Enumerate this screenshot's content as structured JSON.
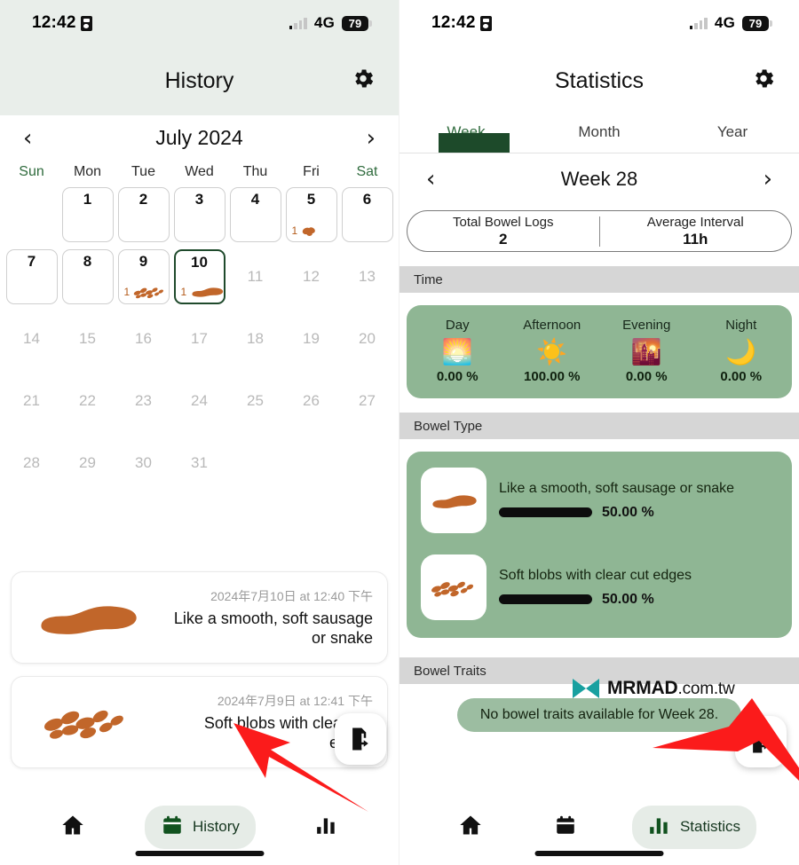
{
  "status_bar": {
    "time": "12:42",
    "network": "4G",
    "battery": "79",
    "record_icon": "record-indicator-icon"
  },
  "left": {
    "nav_title": "History",
    "settings_icon": "gear-icon",
    "calendar": {
      "prev_icon": "chevron-left-icon",
      "next_icon": "chevron-right-icon",
      "month_label": "July 2024",
      "weekdays": [
        "Sun",
        "Mon",
        "Tue",
        "Wed",
        "Thu",
        "Fri",
        "Sat"
      ],
      "lead_blanks": 1,
      "days": [
        {
          "num": "1",
          "boxed": true,
          "today": false,
          "count": null,
          "glyph": null
        },
        {
          "num": "2",
          "boxed": true,
          "today": false,
          "count": null,
          "glyph": null
        },
        {
          "num": "3",
          "boxed": true,
          "today": false,
          "count": null,
          "glyph": null
        },
        {
          "num": "4",
          "boxed": true,
          "today": false,
          "count": null,
          "glyph": null
        },
        {
          "num": "5",
          "boxed": true,
          "today": false,
          "count": "1",
          "glyph": "lumpy"
        },
        {
          "num": "6",
          "boxed": true,
          "today": false,
          "count": null,
          "glyph": null
        },
        {
          "num": "7",
          "boxed": true,
          "today": false,
          "count": null,
          "glyph": null
        },
        {
          "num": "8",
          "boxed": true,
          "today": false,
          "count": null,
          "glyph": null
        },
        {
          "num": "9",
          "boxed": true,
          "today": false,
          "count": "1",
          "glyph": "blobs"
        },
        {
          "num": "10",
          "boxed": true,
          "today": true,
          "count": "1",
          "glyph": "sausage"
        },
        {
          "num": "11",
          "boxed": false,
          "today": false,
          "count": null,
          "glyph": null
        },
        {
          "num": "12",
          "boxed": false,
          "today": false,
          "count": null,
          "glyph": null
        },
        {
          "num": "13",
          "boxed": false,
          "today": false,
          "count": null,
          "glyph": null
        },
        {
          "num": "14",
          "boxed": false,
          "today": false,
          "count": null,
          "glyph": null
        },
        {
          "num": "15",
          "boxed": false,
          "today": false,
          "count": null,
          "glyph": null
        },
        {
          "num": "16",
          "boxed": false,
          "today": false,
          "count": null,
          "glyph": null
        },
        {
          "num": "17",
          "boxed": false,
          "today": false,
          "count": null,
          "glyph": null
        },
        {
          "num": "18",
          "boxed": false,
          "today": false,
          "count": null,
          "glyph": null
        },
        {
          "num": "19",
          "boxed": false,
          "today": false,
          "count": null,
          "glyph": null
        },
        {
          "num": "20",
          "boxed": false,
          "today": false,
          "count": null,
          "glyph": null
        },
        {
          "num": "21",
          "boxed": false,
          "today": false,
          "count": null,
          "glyph": null
        },
        {
          "num": "22",
          "boxed": false,
          "today": false,
          "count": null,
          "glyph": null
        },
        {
          "num": "23",
          "boxed": false,
          "today": false,
          "count": null,
          "glyph": null
        },
        {
          "num": "24",
          "boxed": false,
          "today": false,
          "count": null,
          "glyph": null
        },
        {
          "num": "25",
          "boxed": false,
          "today": false,
          "count": null,
          "glyph": null
        },
        {
          "num": "26",
          "boxed": false,
          "today": false,
          "count": null,
          "glyph": null
        },
        {
          "num": "27",
          "boxed": false,
          "today": false,
          "count": null,
          "glyph": null
        },
        {
          "num": "28",
          "boxed": false,
          "today": false,
          "count": null,
          "glyph": null
        },
        {
          "num": "29",
          "boxed": false,
          "today": false,
          "count": null,
          "glyph": null
        },
        {
          "num": "30",
          "boxed": false,
          "today": false,
          "count": null,
          "glyph": null
        },
        {
          "num": "31",
          "boxed": false,
          "today": false,
          "count": null,
          "glyph": null
        }
      ]
    },
    "logs": [
      {
        "date": "2024年7月10日 at 12:40 下午",
        "desc": "Like a smooth, soft sausage or snake",
        "glyph": "sausage"
      },
      {
        "date": "2024年7月9日 at 12:41 下午",
        "desc": "Soft blobs with clear cut edges",
        "glyph": "blobs"
      }
    ],
    "export_icon": "export-document-icon",
    "tabs": [
      {
        "label": "",
        "icon": "home-icon",
        "active": false
      },
      {
        "label": "History",
        "icon": "calendar-icon",
        "active": true
      },
      {
        "label": "",
        "icon": "bar-chart-icon",
        "active": false
      }
    ]
  },
  "right": {
    "nav_title": "Statistics",
    "settings_icon": "gear-icon",
    "range_tabs": [
      {
        "label": "Week",
        "selected": true
      },
      {
        "label": "Month",
        "selected": false
      },
      {
        "label": "Year",
        "selected": false
      }
    ],
    "period": {
      "prev_icon": "chevron-left-icon",
      "next_icon": "chevron-right-icon",
      "label": "Week 28"
    },
    "summary": [
      {
        "key": "Total Bowel Logs",
        "value": "2"
      },
      {
        "key": "Average Interval",
        "value": "11h"
      }
    ],
    "sections": {
      "time": "Time",
      "bowel_type": "Bowel Type",
      "bowel_traits": "Bowel Traits"
    },
    "time_buckets": [
      {
        "label": "Day",
        "emoji": "🌅",
        "icon": "sunrise-icon",
        "pct": "0.00 %",
        "value": 0
      },
      {
        "label": "Afternoon",
        "emoji": "☀️",
        "icon": "sun-icon",
        "pct": "100.00 %",
        "value": 100
      },
      {
        "label": "Evening",
        "emoji": "🌇",
        "icon": "sunset-icon",
        "pct": "0.00 %",
        "value": 0
      },
      {
        "label": "Night",
        "emoji": "🌙",
        "icon": "moon-icon",
        "pct": "0.00 %",
        "value": 0
      }
    ],
    "bowel_types": [
      {
        "label": "Like a smooth, soft sausage or snake",
        "pct": "50.00 %",
        "value": 50,
        "glyph": "sausage"
      },
      {
        "label": "Soft blobs with clear cut edges",
        "pct": "50.00 %",
        "value": 50,
        "glyph": "blobs"
      }
    ],
    "traits_empty": "No bowel traits available for Week 28.",
    "export_icon": "export-document-icon",
    "tabs": [
      {
        "label": "",
        "icon": "home-icon",
        "active": false
      },
      {
        "label": "",
        "icon": "calendar-icon",
        "active": false
      },
      {
        "label": "Statistics",
        "icon": "bar-chart-icon",
        "active": true
      }
    ]
  },
  "watermark": {
    "text": "MRMAD",
    "suffix": ".com.tw",
    "logo_color": "#18a0a0"
  },
  "colors": {
    "accent_green": "#1d4a2a",
    "card_green": "#8fb694",
    "header_tint": "#e9eeea",
    "stool_brown": "#c1662a",
    "section_gray": "#d6d6d6",
    "arrow_red": "#fb1b1b"
  }
}
